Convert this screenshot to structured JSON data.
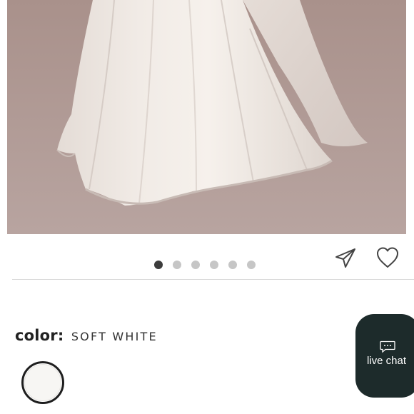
{
  "gallery": {
    "image_alt": "soft white satin wedding gown skirt",
    "slide_count": 6,
    "active_slide": 1
  },
  "actions": {
    "share_icon": "paper-plane-icon",
    "favorite_icon": "heart-icon"
  },
  "product": {
    "color_label": "color:",
    "color_value": "SOFT WHITE",
    "swatch_color": "#f7f6f3"
  },
  "chat": {
    "label": "live chat",
    "icon": "chat-bubble-icon",
    "background": "#1d2b2b"
  }
}
